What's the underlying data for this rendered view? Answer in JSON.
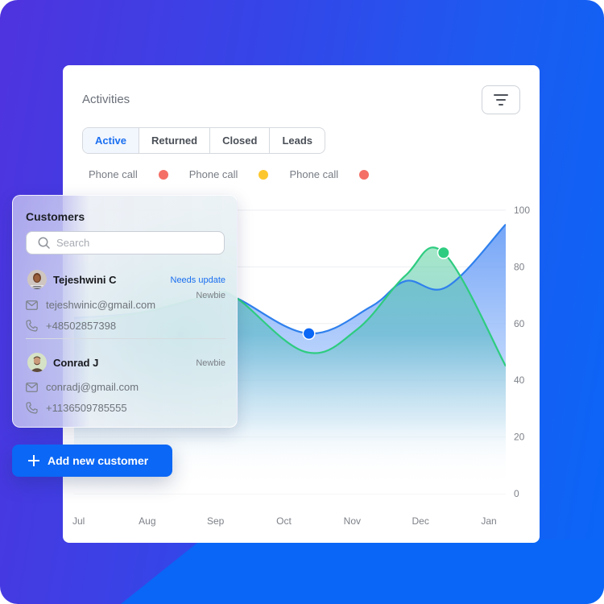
{
  "panel": {
    "title": "Activities",
    "filter_icon": "filter-icon",
    "tabs": [
      {
        "label": "Active",
        "active": true
      },
      {
        "label": "Returned",
        "active": false
      },
      {
        "label": "Closed",
        "active": false
      },
      {
        "label": "Leads",
        "active": false
      }
    ],
    "legend": [
      {
        "label": "Phone call",
        "color": "#f46f66"
      },
      {
        "label": "Phone call",
        "color": "#fcc72e"
      },
      {
        "label": "Phone call",
        "color": "#f46f66"
      }
    ]
  },
  "customers": {
    "title": "Customers",
    "search_placeholder": "Search",
    "search_value": "",
    "people": [
      {
        "name": "Tejeshwini C",
        "status": "Needs update",
        "tag": "Newbie",
        "email": "tejeshwinic@gmail.com",
        "phone": "+48502857398"
      },
      {
        "name": "Conrad J",
        "status": "",
        "tag": "Newbie",
        "email": "conradj@gmail.com",
        "phone": "+1136509785555"
      }
    ],
    "add_button": "Add new customer"
  },
  "colors": {
    "accent": "#0b67f5",
    "blue_series": "#2f80ed",
    "green_series": "#2ecc80",
    "marker_blue": "#0b67f5",
    "marker_green": "#2ecc80"
  },
  "chart_data": {
    "type": "area",
    "title": "",
    "xlabel": "",
    "ylabel": "",
    "categories": [
      "Jul",
      "Aug",
      "Sep",
      "Oct",
      "Nov",
      "Dec",
      "Jan"
    ],
    "yticks": [
      0,
      20,
      40,
      60,
      80,
      100
    ],
    "ylim": [
      0,
      100
    ],
    "grid": true,
    "y_axis_side": "right",
    "series": [
      {
        "name": "Blue",
        "color": "#2f80ed",
        "x": [
          0,
          1,
          2,
          2.35,
          3.4,
          4.3,
          4.8,
          5.4,
          6.25
        ],
        "values": [
          62,
          64,
          70,
          69,
          56.5,
          66,
          75,
          73,
          95
        ],
        "marker": {
          "x": 3.4,
          "value": 56.5
        }
      },
      {
        "name": "Green",
        "color": "#2ecc80",
        "x": [
          0,
          1,
          2,
          2.35,
          3.35,
          4.1,
          4.8,
          5.35,
          6.25
        ],
        "values": [
          60,
          64,
          70,
          69,
          50,
          58,
          77,
          85,
          45
        ],
        "marker": {
          "x": 5.35,
          "value": 85
        }
      }
    ]
  }
}
